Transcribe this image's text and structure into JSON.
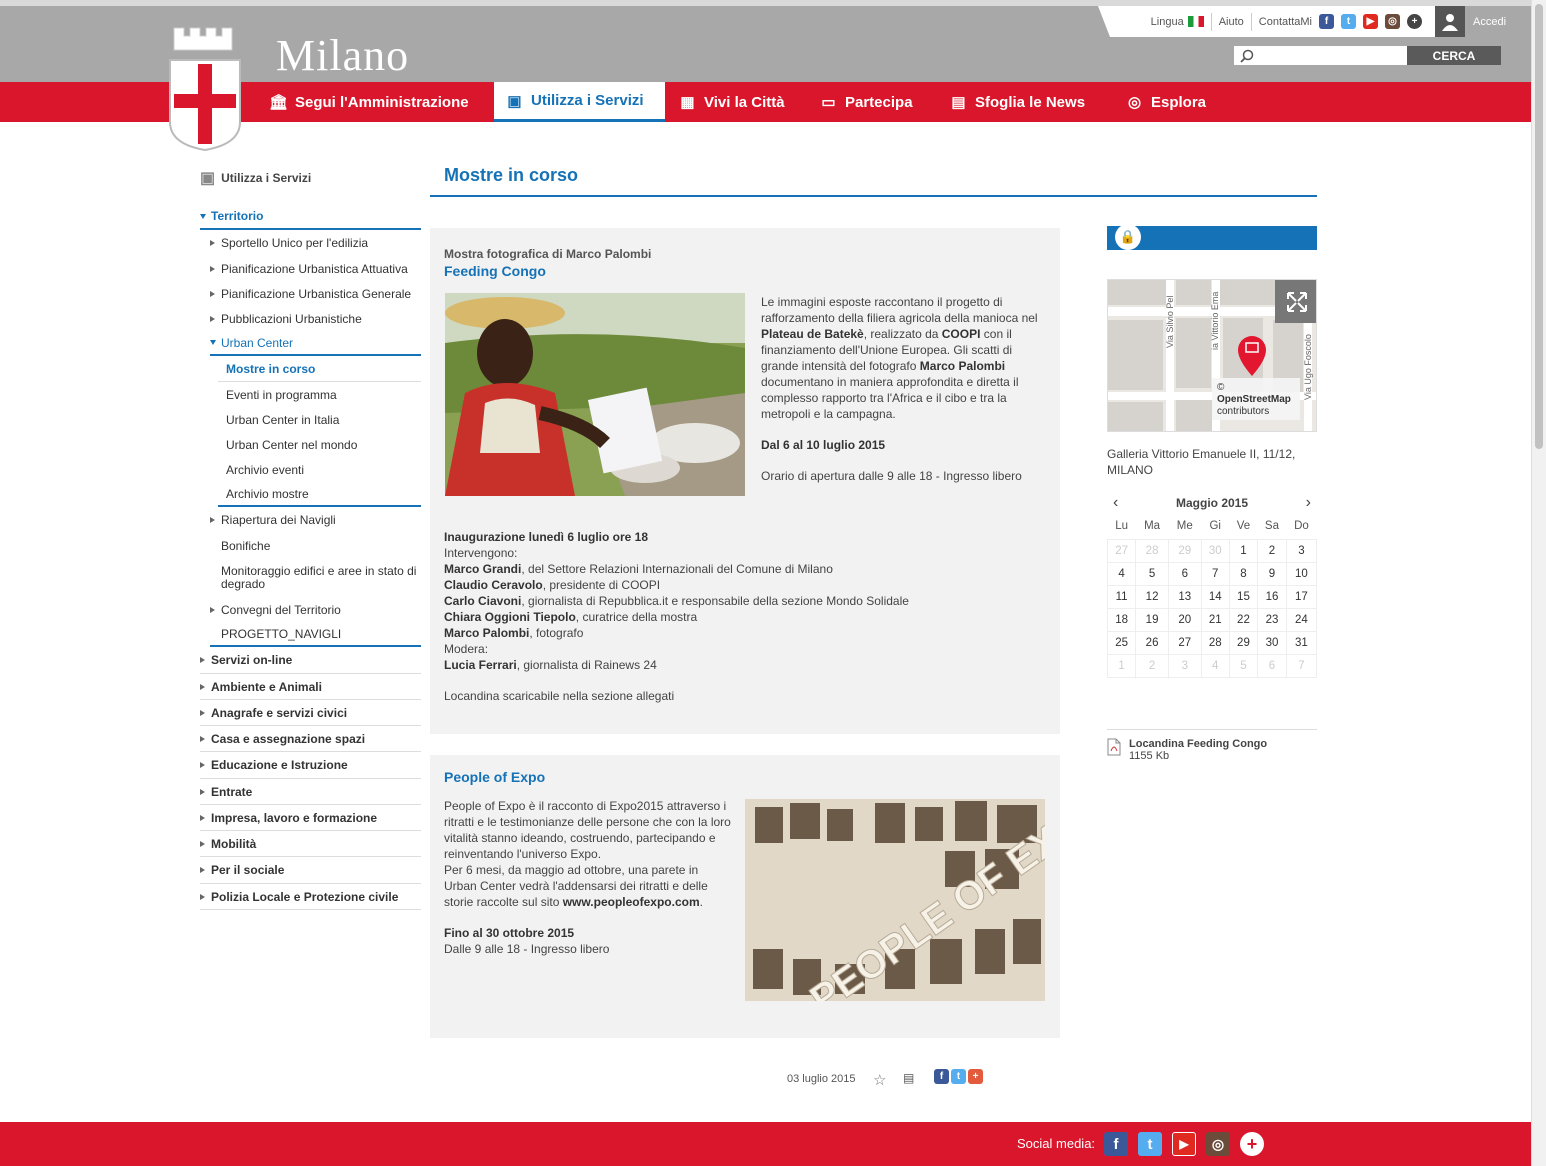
{
  "header": {
    "lang_label": "Lingua",
    "help_label": "Aiuto",
    "contact_label": "ContattaMi",
    "login_label": "Accedi",
    "brand": "Milano",
    "search_button": "CERCA",
    "search_placeholder": ""
  },
  "nav": [
    {
      "label": "Segui l'Amministrazione"
    },
    {
      "label": "Utilizza i Servizi"
    },
    {
      "label": "Vivi la Città"
    },
    {
      "label": "Partecipa"
    },
    {
      "label": "Sfoglia le News"
    },
    {
      "label": "Esplora"
    }
  ],
  "sidebar": {
    "head": "Utilizza i Servizi",
    "territorio": "Territorio",
    "sub": [
      "Sportello Unico per l'edilizia",
      "Pianificazione Urbanistica Attuativa",
      "Pianificazione Urbanistica Generale",
      "Pubblicazioni Urbanistiche"
    ],
    "urban_center": "Urban Center",
    "uc_items": [
      "Mostre in corso",
      "Eventi in programma",
      "Urban Center in Italia",
      "Urban Center nel mondo",
      "Archivio eventi",
      "Archivio mostre"
    ],
    "after": [
      "Riapertura dei Navigli",
      "Bonifiche",
      "Monitoraggio edifici e aree in stato di degrado",
      "Convegni del Territorio",
      "PROGETTO_NAVIGLI"
    ],
    "sections": [
      "Servizi on-line",
      "Ambiente e Animali",
      "Anagrafe e servizi civici",
      "Casa e assegnazione spazi",
      "Educazione e Istruzione",
      "Entrate",
      "Impresa, lavoro e formazione",
      "Mobilità",
      "Per il sociale",
      "Polizia Locale e Protezione civile"
    ]
  },
  "main": {
    "title": "Mostre in corso",
    "card1": {
      "kicker": "Mostra fotografica di Marco Palombi",
      "title": "Feeding Congo",
      "p1_a": "Le immagini esposte raccontano il progetto di rafforzamento della filiera agricola della manioca nel ",
      "p1_b": "Plateau de Batekè",
      "p1_c": ", realizzato da ",
      "p1_d": "COOPI",
      "p1_e": " con il finanziamento dell'Unione Europea. Gli scatti di grande intensità del fotografo ",
      "p1_f": "Marco Palombi",
      "p1_g": " documentano in maniera approfondita e diretta il complesso rapporto tra l'Africa e il cibo e tra la metropoli e la campagna.",
      "dates": "Dal 6 al 10 luglio 2015",
      "hours": "Orario di apertura dalle 9 alle 18 - Ingresso libero",
      "inaug": "Inaugurazione lunedì 6 luglio ore 18",
      "interv": "Intervengono:",
      "speakers": [
        {
          "name": "Marco Grandi",
          "role": ", del Settore Relazioni Internazionali del Comune di Milano"
        },
        {
          "name": "Claudio Ceravolo",
          "role": ", presidente di COOPI"
        },
        {
          "name": "Carlo Ciavoni",
          "role": ", giornalista di Repubblica.it e responsabile della sezione Mondo Solidale"
        },
        {
          "name": "Chiara Oggioni Tiepolo",
          "role": ", curatrice della mostra"
        },
        {
          "name": "Marco Palombi",
          "role": ", fotografo"
        }
      ],
      "modera": "Modera:",
      "moderator": {
        "name": "Lucia Ferrari",
        "role": ", giornalista di Rainews 24"
      },
      "locandina": "Locandina scaricabile nella sezione allegati"
    },
    "card2": {
      "title": "People of Expo",
      "p1": "People of Expo è il racconto di Expo2015 attraverso i ritratti e le testimonianze delle persone che con la loro vitalità stanno ideando, costruendo, partecipando e reinventando l'universo Expo.",
      "p2_a": "Per 6 mesi, da maggio ad ottobre, una parete in Urban Center vedrà l'addensarsi dei ritratti e delle storie raccolte sul sito ",
      "p2_b": "www.peopleofexpo.com",
      "p2_c": ".",
      "until": "Fino al 30 ottobre 2015",
      "hours": "Dalle 9 alle 18 - Ingresso libero",
      "photo_text": "PEOPLE OF EXPO"
    },
    "date": "03 luglio 2015"
  },
  "right": {
    "map_attr_symbol": "©",
    "map_attr": "OpenStreetMap",
    "map_attr2": "contributors",
    "streets": [
      "Via Silvio Pel",
      "ia Vittorio Ema",
      "Via Ugo Foscolo"
    ],
    "address1": "Galleria Vittorio Emanuele II, 11/12,",
    "address2": "MILANO",
    "cal_month": "Maggio 2015",
    "cal_days": [
      "Lu",
      "Ma",
      "Me",
      "Gi",
      "Ve",
      "Sa",
      "Do"
    ],
    "cal_weeks": [
      [
        "27",
        "28",
        "29",
        "30",
        "1",
        "2",
        "3"
      ],
      [
        "4",
        "5",
        "6",
        "7",
        "8",
        "9",
        "10"
      ],
      [
        "11",
        "12",
        "13",
        "14",
        "15",
        "16",
        "17"
      ],
      [
        "18",
        "19",
        "20",
        "21",
        "22",
        "23",
        "24"
      ],
      [
        "25",
        "26",
        "27",
        "28",
        "29",
        "30",
        "31"
      ],
      [
        "1",
        "2",
        "3",
        "4",
        "5",
        "6",
        "7"
      ]
    ],
    "attachment": "Locandina Feeding Congo",
    "attachment_size": "1155 Kb"
  },
  "footer": {
    "social_label": "Social media:"
  },
  "colors": {
    "red": "#d9162b",
    "blue": "#1572b6",
    "grey": "#a8a8a8"
  }
}
